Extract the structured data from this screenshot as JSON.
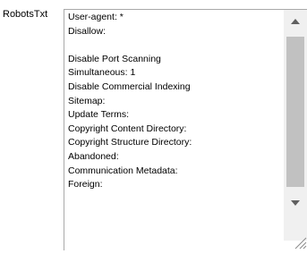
{
  "field": {
    "label": "RobotsTxt",
    "lines": [
      "User-agent: *",
      "Disallow:",
      "",
      "Disable Port Scanning",
      "Simultaneous: 1",
      "Disable Commercial Indexing",
      "Sitemap:",
      "Update Terms:",
      "Copyright Content Directory:",
      "Copyright Structure Directory:",
      "Abandoned:",
      "Communication Metadata:",
      "Foreign:"
    ]
  },
  "icons": {
    "scroll_up": "triangle-up-icon",
    "scroll_down": "triangle-down-icon",
    "resize": "resize-grip-icon"
  },
  "colors": {
    "border": "#a9a9a9",
    "scrollbar_track": "#f0f0f0",
    "scrollbar_thumb": "#c1c1c1",
    "arrow": "#606060"
  }
}
